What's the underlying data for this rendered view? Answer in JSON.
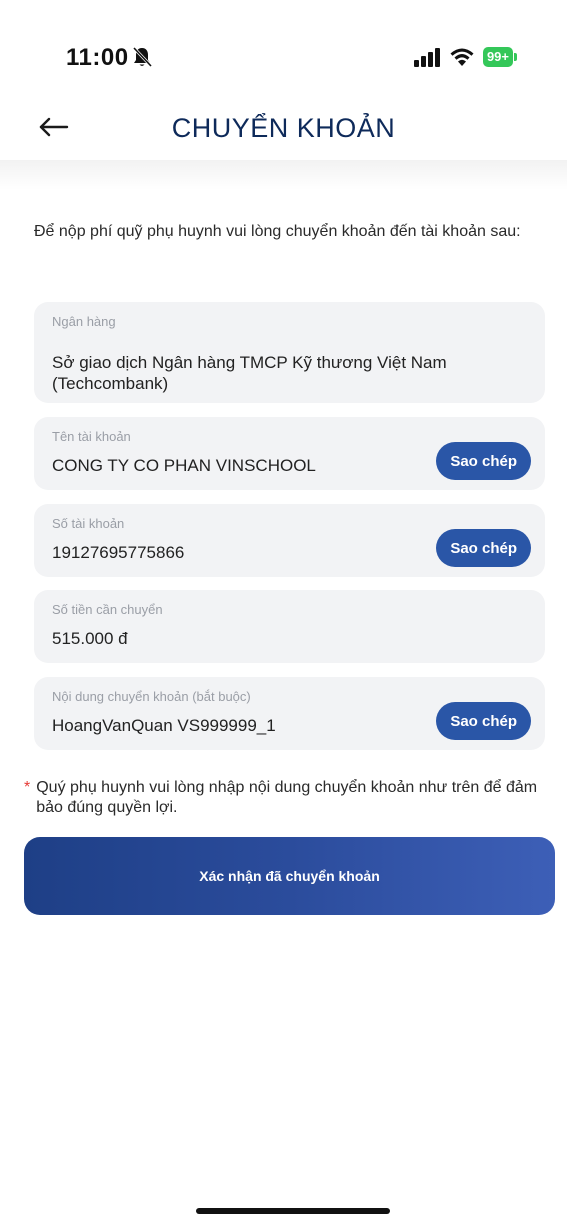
{
  "status_bar": {
    "time": "11:00",
    "battery": "99+"
  },
  "header": {
    "title": "CHUYỂN KHOẢN"
  },
  "intro": "Để nộp phí quỹ phụ huynh vui lòng chuyển khoản đến tài khoản sau:",
  "fields": [
    {
      "label": "Ngân hàng",
      "value": "Sở giao dịch Ngân hàng TMCP Kỹ thương Việt Nam (Techcombank)"
    },
    {
      "label": "Tên tài khoản",
      "value": "CONG TY CO PHAN VINSCHOOL",
      "copy_label": "Sao chép"
    },
    {
      "label": "Số tài khoản",
      "value": "19127695775866",
      "copy_label": "Sao chép"
    },
    {
      "label": "Số tiền cần chuyển",
      "value": "515.000 đ"
    },
    {
      "label": "Nội dung chuyển khoản (bắt buộc)",
      "value": "HoangVanQuan VS999999_1",
      "copy_label": "Sao chép"
    }
  ],
  "note": {
    "marker": "*",
    "text": "Quý phụ huynh vui lòng nhập nội dung chuyển khoản như trên để đảm bảo đúng quyền lợi."
  },
  "confirm_button": "Xác nhận đã chuyển khoản",
  "colors": {
    "accent": "#2a56a7",
    "title": "#0e2a5a",
    "card_bg": "#f2f3f5",
    "warning": "#e53935",
    "battery": "#34c759"
  }
}
